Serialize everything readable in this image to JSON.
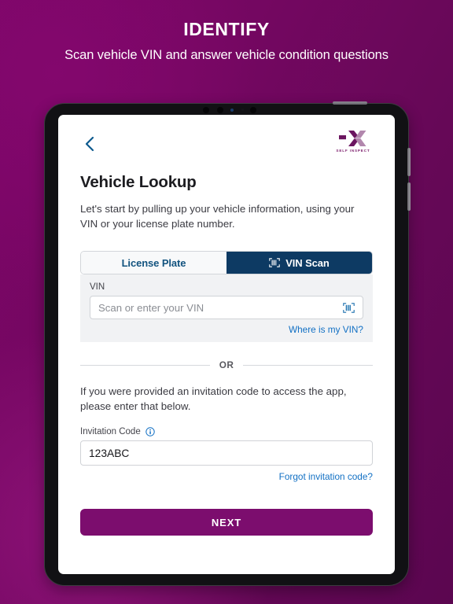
{
  "promo": {
    "title": "IDENTIFY",
    "subtitle": "Scan vehicle VIN and answer vehicle condition questions",
    "background_start": "#7d0668",
    "background_end": "#5b0650"
  },
  "app": {
    "back_icon": "chevron-left-icon",
    "brand": {
      "mark_icon": "self-inspect-x-logo",
      "wordmark": "SELF INSPECT",
      "color_dark": "#6b1560",
      "color_light": "#b287ad"
    },
    "page_title": "Vehicle Lookup",
    "page_lede": "Let's start by pulling up your vehicle information, using your VIN or your license plate number.",
    "lookup_tabs": [
      {
        "label": "License Plate",
        "active": false,
        "icon": null
      },
      {
        "label": "VIN Scan",
        "active": true,
        "icon": "barcode-scan-icon"
      }
    ],
    "vin_section": {
      "label": "VIN",
      "placeholder": "Scan or enter your VIN",
      "value": "",
      "scan_icon": "barcode-scan-icon",
      "help_link": "Where is my VIN?"
    },
    "divider_text": "OR",
    "invite_lede": "If you were provided an invitation code to access the app, please enter that below.",
    "invite_section": {
      "label": "Invitation Code",
      "info_icon": "info-circle-icon",
      "value": "123ABC",
      "placeholder": "",
      "help_link": "Forgot invitation code?"
    },
    "next_label": "NEXT",
    "accent_blue": "#1270c4",
    "accent_navy": "#0d3a63",
    "accent_purple": "#7c0d6e"
  }
}
